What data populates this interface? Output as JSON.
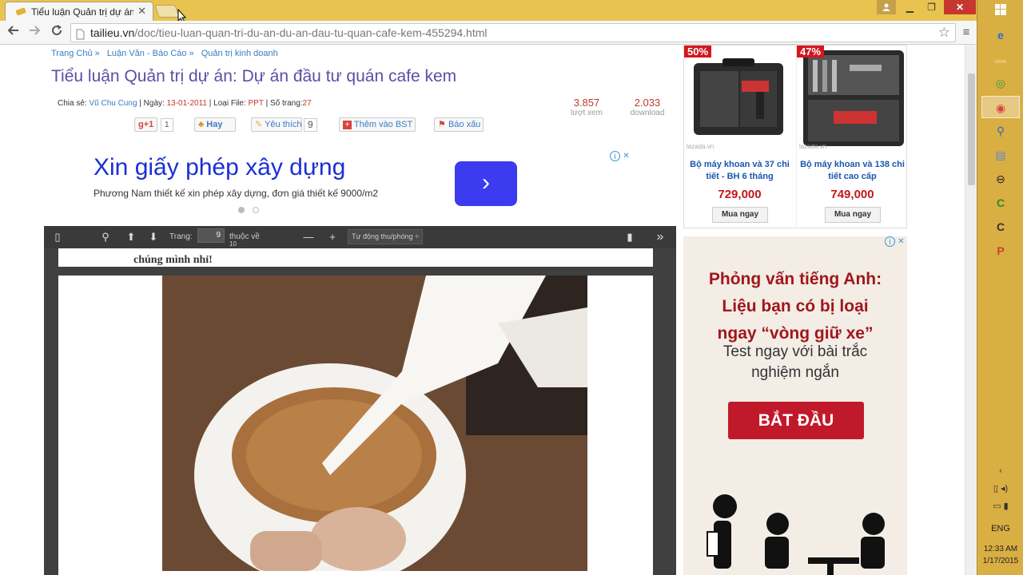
{
  "browser": {
    "tab_title": "Tiểu luận Quản trị dự án: D",
    "tab_close": "✕",
    "url_host": "tailieu.vn",
    "url_path": "/doc/tieu-luan-quan-tri-du-an-du-an-dau-tu-quan-cafe-kem-455294.html",
    "back_icon": "back-arrow-icon",
    "forward_icon": "forward-arrow-icon",
    "reload_icon": "reload-icon",
    "star_icon": "bookmark-star-icon",
    "menu_icon": "hamburger-menu-icon"
  },
  "page": {
    "breadcrumb": [
      "Trang Chủ »",
      "Luận Văn - Báo Cáo »",
      "Quản trị kinh doanh"
    ],
    "title": "Tiểu luận Quản trị dự án: Dự án đầu tư quán cafe kem",
    "meta": {
      "share_label": "Chia sẻ:",
      "author": "Vũ Chu Cung",
      "date_label": " | Ngày:",
      "date": "13-01-2011",
      "filetype_label": " | Loại File:",
      "filetype": "PPT",
      "pages_label": " | Số trang:",
      "pages": "27"
    },
    "stats": {
      "views": "3.857",
      "views_label": "lượt xem",
      "downloads": "2.033",
      "downloads_label": "download"
    },
    "social": {
      "gplus": "g+1",
      "gplus_count": "1",
      "hay": "Hay",
      "like": "Yêu thích",
      "like_count": "9",
      "add_bst": "Thêm vào BST",
      "report": "Báo xấu"
    }
  },
  "banner_ad": {
    "headline": "Xin giấy phép xây dựng",
    "subtext": "Phương Nam thiết kế xin phép xây dựng, đơn giá thiết kế 9000/m2",
    "button": "›",
    "adchoices": "i",
    "close": "✕"
  },
  "viewer": {
    "page_label": "Trang:",
    "page_value": "9",
    "of_label": "thuộc về",
    "total": "10",
    "zoom_minus": "—",
    "zoom_plus": "+",
    "zoom_mode": "Tự động thu/phóng ÷",
    "more": "»",
    "pdf_text": "chúng mình nhỉ!"
  },
  "product_ad": {
    "products": [
      {
        "discount": "50%",
        "source": "lazada.vn",
        "name": "Bộ máy khoan và 37 chi tiết - BH 6 tháng",
        "price": "729,000",
        "buy": "Mua ngay"
      },
      {
        "discount": "47%",
        "source": "lazada.vn",
        "name": "Bộ máy khoan và 138 chi tiết cao cấp",
        "price": "749,000",
        "buy": "Mua ngay"
      }
    ]
  },
  "side_ad": {
    "line1": "Phỏng vấn tiếng Anh:",
    "line2": "Liệu bạn có bị loại",
    "line3": "ngay “vòng giữ xe”",
    "sub1": "Test ngay với bài trắc",
    "sub2": "nghiệm ngắn",
    "cta": "BẮT ĐẦU"
  },
  "taskbar": {
    "lang": "ENG",
    "time": "12:33 AM",
    "date": "1/17/2015"
  },
  "colors": {
    "title_bar": "#e9c34f",
    "taskbar": "#d9ae43",
    "page_title": "#5b4fa8",
    "link": "#3a7cc4",
    "accent_red": "#c0392b"
  }
}
